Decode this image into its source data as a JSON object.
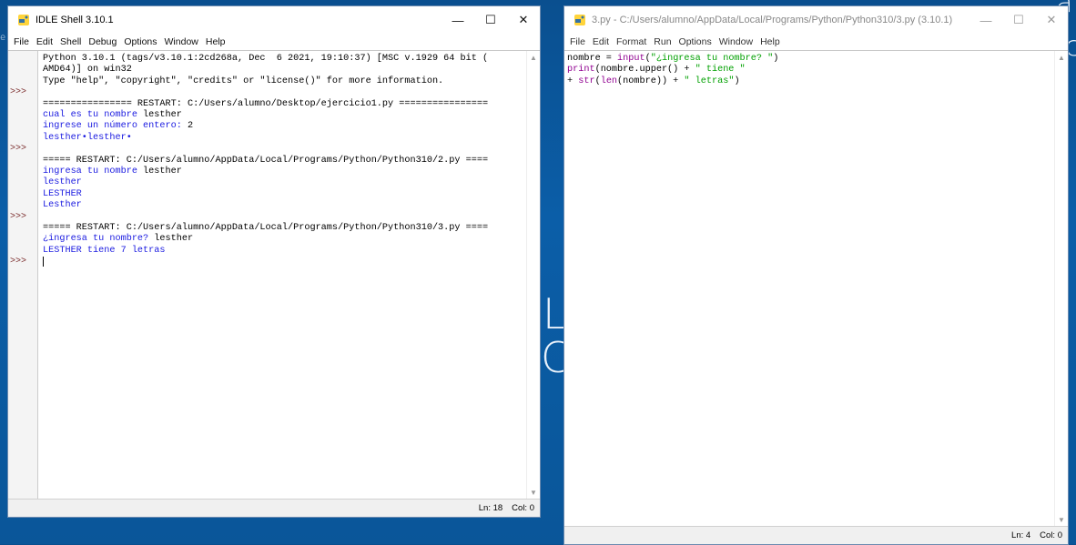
{
  "shell": {
    "title": "IDLE Shell 3.10.1",
    "menu": [
      "File",
      "Edit",
      "Shell",
      "Debug",
      "Options",
      "Window",
      "Help"
    ],
    "lines": [
      {
        "prompt": "",
        "text": "Python 3.10.1 (tags/v3.10.1:2cd268a, Dec  6 2021, 19:10:37) [MSC v.1929 64 bit (",
        "cls": ""
      },
      {
        "prompt": "",
        "text": "AMD64)] on win32",
        "cls": ""
      },
      {
        "prompt": "",
        "text": "Type \"help\", \"copyright\", \"credits\" or \"license()\" for more information.",
        "cls": ""
      },
      {
        "prompt": ">>>",
        "text": "",
        "cls": ""
      },
      {
        "prompt": "",
        "text": "================ RESTART: C:/Users/alumno/Desktop/ejercicio1.py ================",
        "cls": ""
      },
      {
        "prompt": "",
        "text": "cual es tu nombre lesther",
        "cls": "mixed1"
      },
      {
        "prompt": "",
        "text": "ingrese un número entero: 2",
        "cls": "mixed2"
      },
      {
        "prompt": "",
        "text": "lesther•lesther•",
        "cls": "out"
      },
      {
        "prompt": ">>>",
        "text": "",
        "cls": ""
      },
      {
        "prompt": "",
        "text": "===== RESTART: C:/Users/alumno/AppData/Local/Programs/Python/Python310/2.py ====",
        "cls": ""
      },
      {
        "prompt": "",
        "text": "ingresa tu nombre lesther",
        "cls": "mixed3"
      },
      {
        "prompt": "",
        "text": "lesther",
        "cls": "out"
      },
      {
        "prompt": "",
        "text": "LESTHER",
        "cls": "out"
      },
      {
        "prompt": "",
        "text": "Lesther",
        "cls": "out"
      },
      {
        "prompt": ">>>",
        "text": "",
        "cls": ""
      },
      {
        "prompt": "",
        "text": "===== RESTART: C:/Users/alumno/AppData/Local/Programs/Python/Python310/3.py ====",
        "cls": ""
      },
      {
        "prompt": "",
        "text": "¿ingresa tu nombre? lesther",
        "cls": "mixed4"
      },
      {
        "prompt": "",
        "text": "LESTHER tiene 7 letras",
        "cls": "out"
      },
      {
        "prompt": ">>>",
        "text": "",
        "cls": "cursor"
      }
    ],
    "status_ln": "Ln: 18",
    "status_col": "Col: 0"
  },
  "editor": {
    "title": "3.py - C:/Users/alumno/AppData/Local/Programs/Python/Python310/3.py (3.10.1)",
    "menu": [
      "File",
      "Edit",
      "Format",
      "Run",
      "Options",
      "Window",
      "Help"
    ],
    "code": [
      "nombre = input(\"¿ingresa tu nombre? \")",
      "print(nombre.upper() + \" tiene \"",
      "+ str(len(nombre)) + \" letras\")"
    ],
    "status_ln": "Ln: 4",
    "status_col": "Col: 0"
  },
  "window_controls": {
    "minimize": "—",
    "maximize": "☐",
    "close": "✕"
  }
}
